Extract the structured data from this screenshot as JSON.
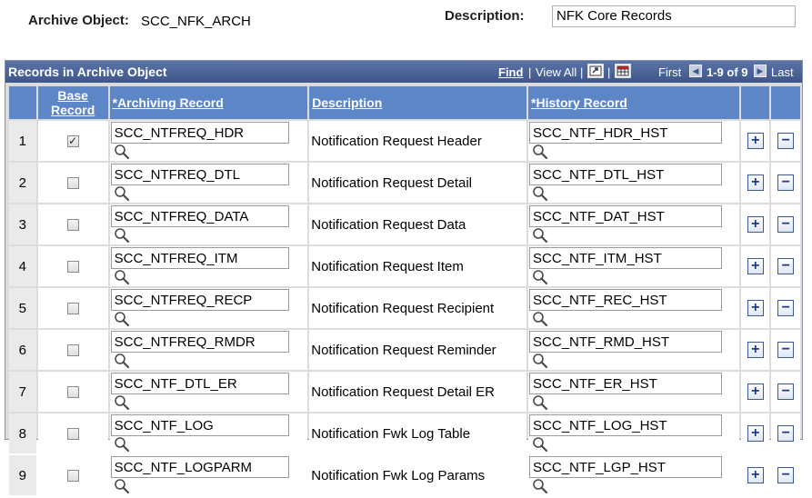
{
  "header": {
    "archive_object_label": "Archive Object:",
    "archive_object_value": "SCC_NFK_ARCH",
    "description_label": "Description:",
    "description_value": "NFK Core Records"
  },
  "grid": {
    "title": "Records in Archive Object",
    "nav": {
      "find": "Find",
      "separator": "|",
      "view_all": "View All",
      "first": "First",
      "range": "1-9 of 9",
      "last": "Last"
    },
    "columns": {
      "base_record_line1": "Base",
      "base_record_line2": "Record",
      "archiving_record": "*Archiving Record",
      "description": "Description",
      "history_record": "*History Record"
    },
    "rows": [
      {
        "num": "1",
        "base": true,
        "archiving": "SCC_NTFREQ_HDR",
        "description": "Notification Request Header",
        "history": "SCC_NTF_HDR_HST"
      },
      {
        "num": "2",
        "base": false,
        "archiving": "SCC_NTFREQ_DTL",
        "description": "Notification Request Detail",
        "history": "SCC_NTF_DTL_HST"
      },
      {
        "num": "3",
        "base": false,
        "archiving": "SCC_NTFREQ_DATA",
        "description": "Notification Request Data",
        "history": "SCC_NTF_DAT_HST"
      },
      {
        "num": "4",
        "base": false,
        "archiving": "SCC_NTFREQ_ITM",
        "description": "Notification Request Item",
        "history": "SCC_NTF_ITM_HST"
      },
      {
        "num": "5",
        "base": false,
        "archiving": "SCC_NTFREQ_RECP",
        "description": "Notification Request Recipient",
        "history": "SCC_NTF_REC_HST"
      },
      {
        "num": "6",
        "base": false,
        "archiving": "SCC_NTFREQ_RMDR",
        "description": "Notification Request Reminder",
        "history": "SCC_NTF_RMD_HST"
      },
      {
        "num": "7",
        "base": false,
        "archiving": "SCC_NTF_DTL_ER",
        "description": "Notification Request Detail ER",
        "history": "SCC_NTF_ER_HST"
      },
      {
        "num": "8",
        "base": false,
        "archiving": "SCC_NTF_LOG",
        "description": "Notification Fwk Log Table",
        "history": "SCC_NTF_LOG_HST"
      },
      {
        "num": "9",
        "base": false,
        "archiving": "SCC_NTF_LOGPARM",
        "description": "Notification Fwk Log Params",
        "history": "SCC_NTF_LGP_HST"
      }
    ]
  },
  "icons": {
    "lookup": "magnifier-icon",
    "add_row": "plus-icon",
    "delete_row": "minus-icon",
    "zoom": "zoom-grid-icon",
    "download": "download-grid-icon",
    "prev": "prev-arrow-icon",
    "next": "next-arrow-icon"
  },
  "symbols": {
    "plus": "+",
    "minus": "−",
    "check": "✓"
  }
}
